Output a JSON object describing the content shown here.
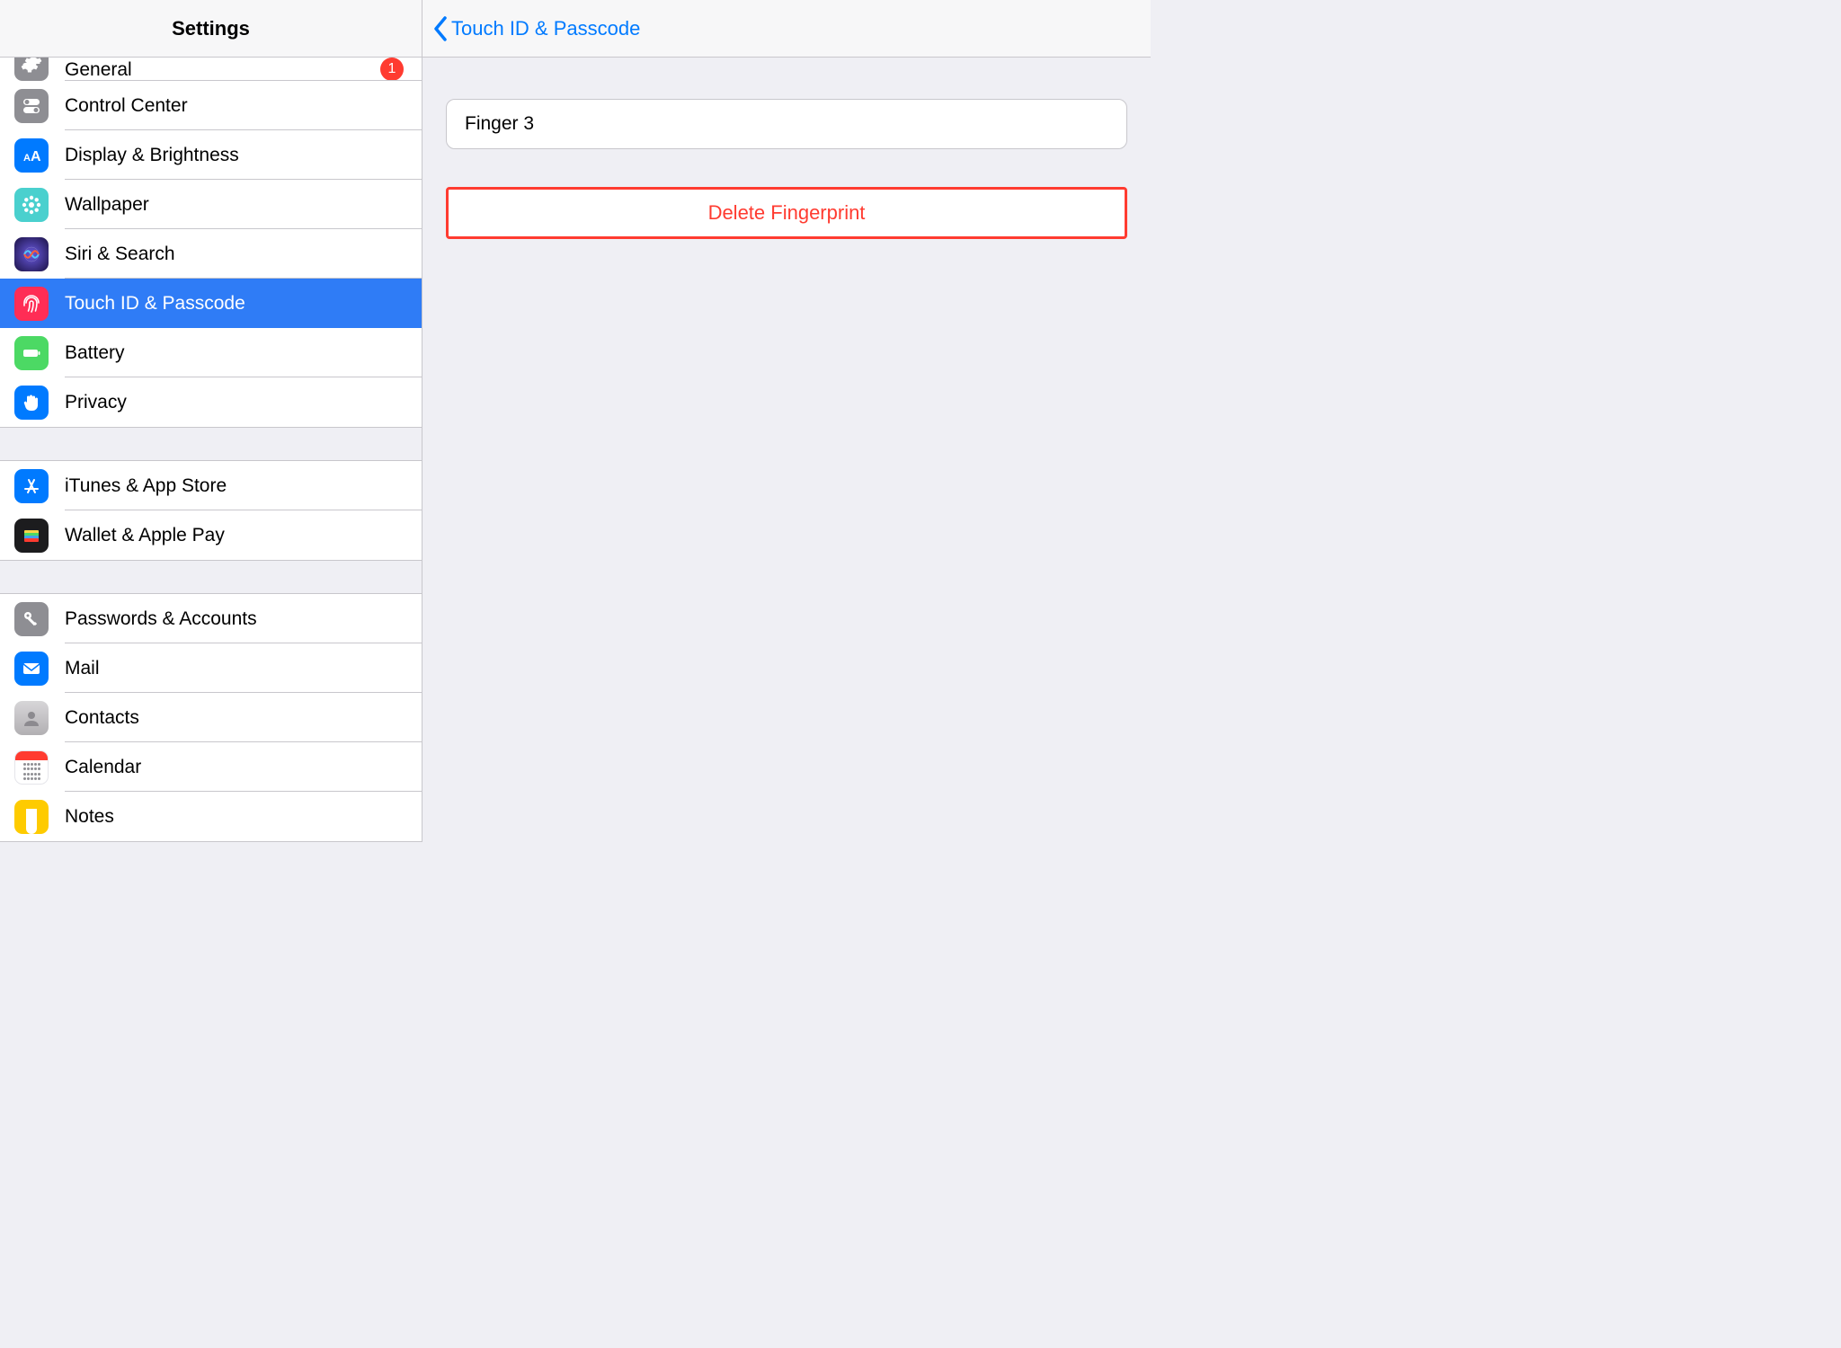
{
  "sidebar": {
    "title": "Settings",
    "groups": [
      {
        "items": [
          {
            "key": "general",
            "label": "General",
            "icon": "gear-icon",
            "bg": "bg-gray",
            "badge": "1",
            "half": true
          },
          {
            "key": "control-center",
            "label": "Control Center",
            "icon": "toggles-icon",
            "bg": "bg-gray"
          },
          {
            "key": "display",
            "label": "Display & Brightness",
            "icon": "text-size-icon",
            "bg": "bg-blue"
          },
          {
            "key": "wallpaper",
            "label": "Wallpaper",
            "icon": "flower-icon",
            "bg": "bg-teal"
          },
          {
            "key": "siri",
            "label": "Siri & Search",
            "icon": "siri-icon",
            "bg": "siri-bg"
          },
          {
            "key": "touchid",
            "label": "Touch ID & Passcode",
            "icon": "fingerprint-icon",
            "bg": "bg-red",
            "selected": true
          },
          {
            "key": "battery",
            "label": "Battery",
            "icon": "battery-icon",
            "bg": "bg-green"
          },
          {
            "key": "privacy",
            "label": "Privacy",
            "icon": "hand-icon",
            "bg": "bg-blue"
          }
        ]
      },
      {
        "items": [
          {
            "key": "itunes",
            "label": "iTunes & App Store",
            "icon": "appstore-icon",
            "bg": "bg-blue"
          },
          {
            "key": "wallet",
            "label": "Wallet & Apple Pay",
            "icon": "wallet-icon",
            "bg": "wallet-bg"
          }
        ]
      },
      {
        "items": [
          {
            "key": "passwords",
            "label": "Passwords & Accounts",
            "icon": "key-icon",
            "bg": "bg-gray"
          },
          {
            "key": "mail",
            "label": "Mail",
            "icon": "mail-icon",
            "bg": "bg-blue"
          },
          {
            "key": "contacts",
            "label": "Contacts",
            "icon": "contacts-icon",
            "bg": "contacts-bg"
          },
          {
            "key": "calendar",
            "label": "Calendar",
            "icon": "calendar-icon",
            "bg": "bg-calendar"
          },
          {
            "key": "notes",
            "label": "Notes",
            "icon": "notes-icon",
            "bg": "bg-notes"
          }
        ]
      }
    ]
  },
  "detail": {
    "back_label": "Touch ID & Passcode",
    "finger_name": "Finger 3",
    "delete_label": "Delete Fingerprint"
  }
}
